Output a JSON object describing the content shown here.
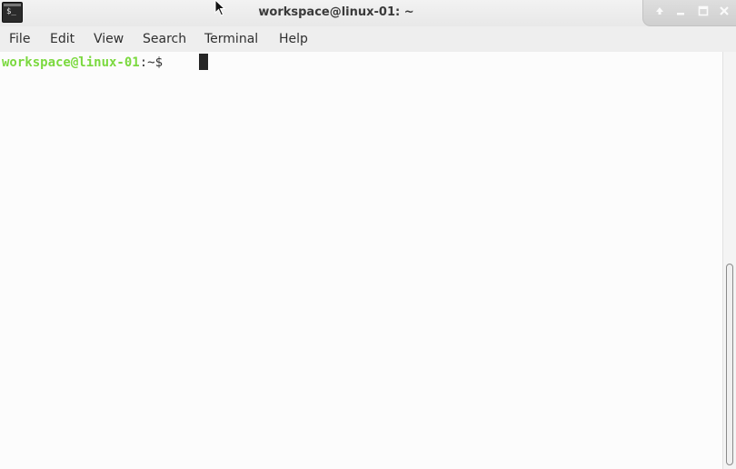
{
  "window": {
    "title": "workspace@linux-01: ~",
    "app_icon": "terminal-icon",
    "buttons": [
      "arrow-up-icon",
      "minimize-icon",
      "maximize-icon",
      "close-icon"
    ]
  },
  "menubar": {
    "items": [
      "File",
      "Edit",
      "View",
      "Search",
      "Terminal",
      "Help"
    ]
  },
  "terminal": {
    "prompt_user": "workspace@linux-01",
    "prompt_rest": ":~$ ",
    "colors": {
      "prompt": "#7bd93f",
      "text": "#333333",
      "background": "#fcfcfc",
      "cursor": "#262626"
    }
  }
}
